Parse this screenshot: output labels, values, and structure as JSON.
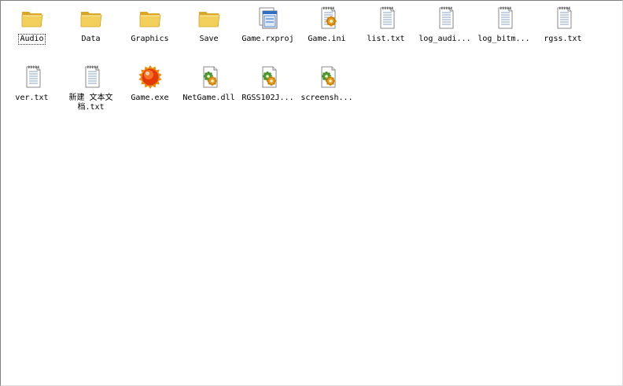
{
  "explorer": {
    "items": [
      {
        "label": "Audio",
        "icon": "folder-icon",
        "selected": true
      },
      {
        "label": "Data",
        "icon": "folder-icon"
      },
      {
        "label": "Graphics",
        "icon": "folder-icon"
      },
      {
        "label": "Save",
        "icon": "folder-icon"
      },
      {
        "label": "Game.rxproj",
        "icon": "project-file-icon"
      },
      {
        "label": "Game.ini",
        "icon": "ini-settings-icon"
      },
      {
        "label": "list.txt",
        "icon": "text-document-icon"
      },
      {
        "label": "log_audi...",
        "icon": "text-document-icon"
      },
      {
        "label": "log_bitm...",
        "icon": "text-document-icon"
      },
      {
        "label": "rgss.txt",
        "icon": "text-document-icon"
      },
      {
        "label": "ver.txt",
        "icon": "text-document-icon"
      },
      {
        "label": "新建 文本文\n档.txt",
        "icon": "text-document-icon"
      },
      {
        "label": "Game.exe",
        "icon": "game-exe-icon"
      },
      {
        "label": "NetGame.dll",
        "icon": "dll-file-icon"
      },
      {
        "label": "RGSS102J...",
        "icon": "dll-file-icon"
      },
      {
        "label": "screensh...",
        "icon": "dll-file-icon"
      }
    ]
  },
  "colors": {
    "folder": "#f2cf5b",
    "folder_dark": "#d9a628",
    "exe_orange": "#f08a0a",
    "exe_red": "#e23a00",
    "dll_green": "#3ea13a",
    "gear_orange": "#e79a1b",
    "doc_blue_lines": "#8aa3c4",
    "project_blue": "#2f6fc4"
  }
}
